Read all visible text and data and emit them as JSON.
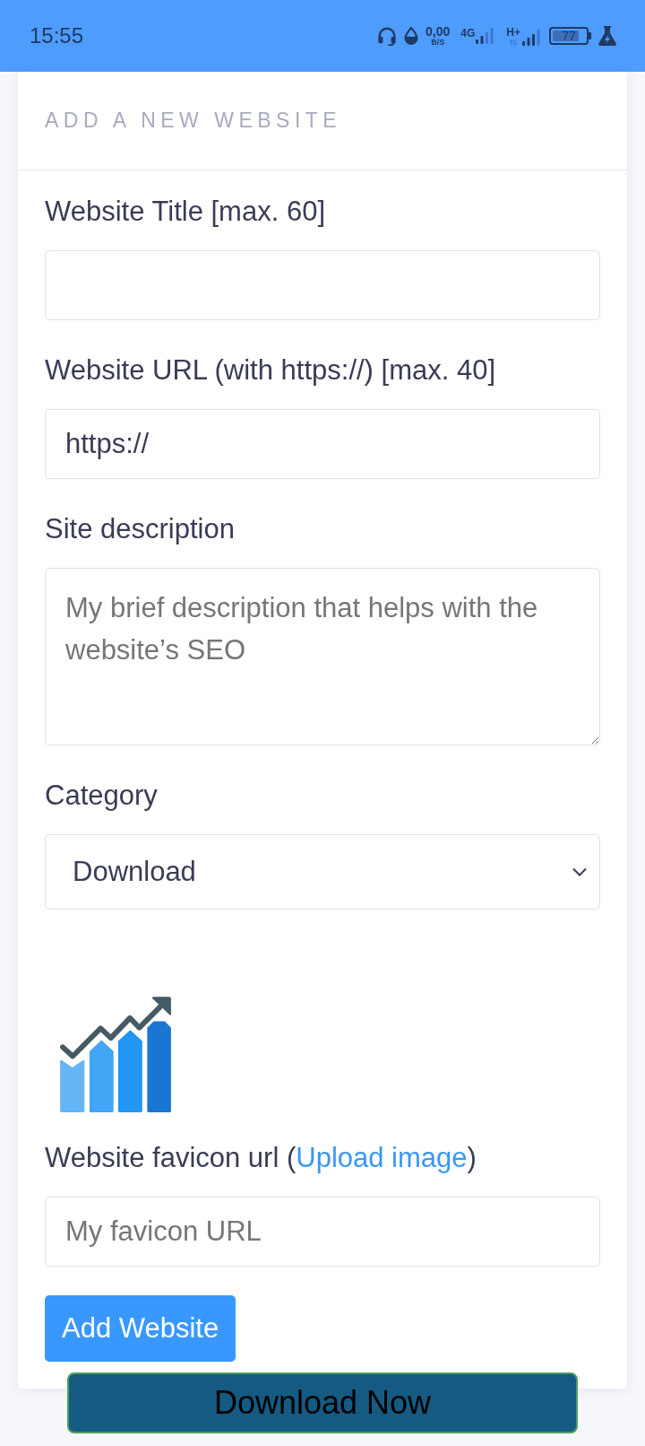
{
  "status_bar": {
    "time": "15:55",
    "speed": "0,00",
    "speed_unit": "B/S",
    "network_1": "4G",
    "network_2": "H+",
    "battery": "77"
  },
  "form": {
    "title": "ADD A NEW WEBSITE",
    "fields": [
      {
        "kind": "text",
        "label": "Website Title [max. 60]"
      },
      {
        "kind": "text",
        "label": "Website URL (with https://) [max. 40]",
        "value": "https://"
      },
      {
        "kind": "textarea",
        "label": "Site description",
        "placeholder": "My brief description that helps with the website’s SEO"
      },
      {
        "kind": "select",
        "label": "Category",
        "value": "Download"
      },
      {
        "kind": "favicon",
        "label": "Website favicon url (",
        "label_link": "Upload image",
        "label_after": ")",
        "placeholder": "My favicon URL"
      }
    ],
    "submit": "Add Website"
  },
  "floating_button": "Download Now"
}
